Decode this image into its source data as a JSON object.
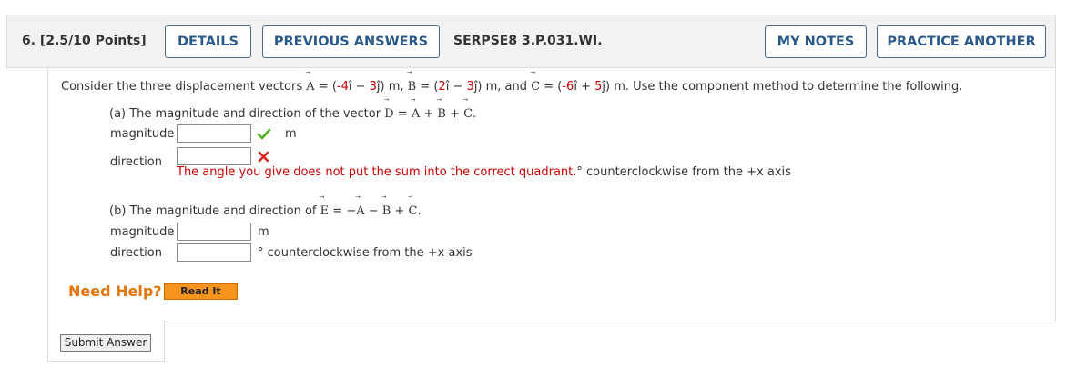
{
  "header": {
    "question_number": "6.  [2.5/10 Points]",
    "details_label": "DETAILS",
    "previous_answers_label": "PREVIOUS ANSWERS",
    "assignment_id": "SERPSE8 3.P.031.WI.",
    "my_notes_label": "MY NOTES",
    "practice_another_label": "PRACTICE ANOTHER"
  },
  "problem": {
    "intro_before": "Consider the three displacement vectors ",
    "vec_a": "A",
    "vec_a_eq": " = (",
    "vec_a_x": "-4",
    "vec_a_mid": "î − ",
    "vec_a_y": "3",
    "vec_a_end": "ĵ) m, ",
    "vec_b": "B",
    "vec_b_eq": " = (",
    "vec_b_x": "2",
    "vec_b_mid": "î − ",
    "vec_b_y": "3",
    "vec_b_end": "ĵ) m, and ",
    "vec_c": "C",
    "vec_c_eq": " = (",
    "vec_c_x": "-6",
    "vec_c_mid": "î + ",
    "vec_c_y": "5",
    "vec_c_end": "ĵ) m. Use the component method to determine the following.",
    "arrow": "⃗"
  },
  "part_a": {
    "prompt": "(a) The magnitude and direction of the vector ",
    "vec_d": "D",
    "equation": " = ",
    "plus": " + ",
    "period": ".",
    "magnitude_label": "magnitude",
    "magnitude_value": "",
    "magnitude_unit": "m",
    "direction_label": "direction",
    "direction_value": "",
    "feedback": "The angle you give does not put the sum into the correct quadrant.",
    "direction_unit": "° counterclockwise from the +x axis"
  },
  "part_b": {
    "prompt": "(b) The magnitude and direction of ",
    "vec_e": "E",
    "equation": " = −",
    "minus": " − ",
    "plus": " + ",
    "period": ".",
    "magnitude_label": "magnitude",
    "magnitude_value": "",
    "magnitude_unit": "m",
    "direction_label": "direction",
    "direction_value": "",
    "direction_unit": "° counterclockwise from the +x axis"
  },
  "help": {
    "label": "Need Help?",
    "read_it_label": "Read It"
  },
  "submit_label": "Submit Answer",
  "icons": {
    "correct": "check-icon",
    "incorrect": "cross-icon"
  },
  "colors": {
    "button_text": "#2b5a8a",
    "error": "#cc0000",
    "correct": "#4caf1f",
    "help": "#e8750a",
    "read_it_bg": "#f7941d"
  }
}
